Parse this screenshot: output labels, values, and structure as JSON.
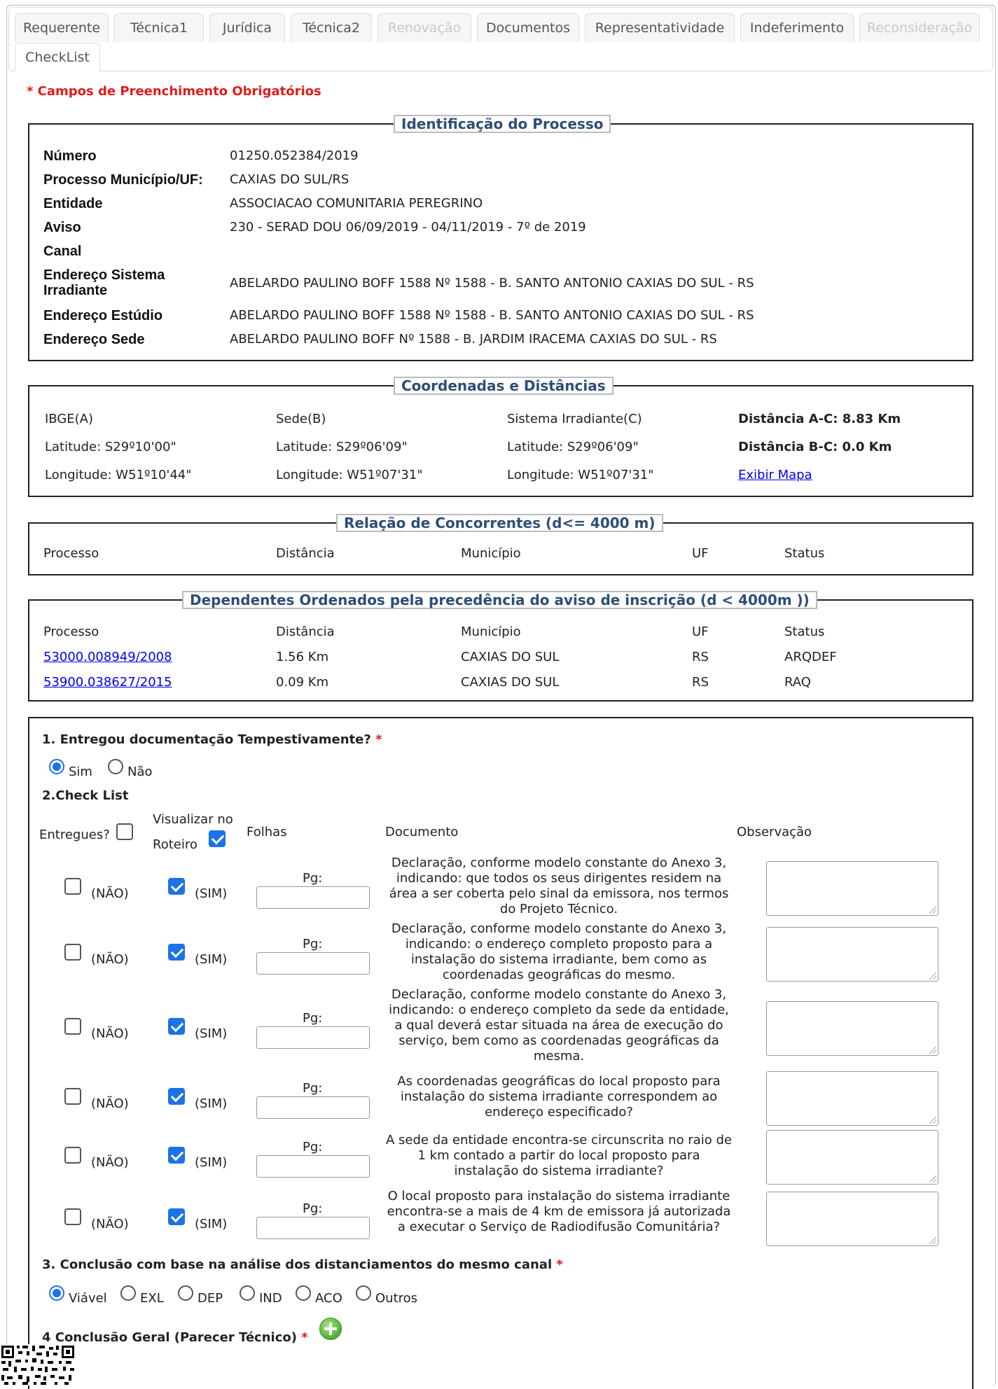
{
  "tabs": [
    {
      "label": "Requerente",
      "state": "normal"
    },
    {
      "label": "Técnica1",
      "state": "normal"
    },
    {
      "label": "Jurídica",
      "state": "normal"
    },
    {
      "label": "Técnica2",
      "state": "normal"
    },
    {
      "label": "Renovação",
      "state": "disabled"
    },
    {
      "label": "Documentos",
      "state": "normal"
    },
    {
      "label": "Representatividade",
      "state": "normal"
    },
    {
      "label": "Indeferimento",
      "state": "normal"
    },
    {
      "label": "Reconsideração",
      "state": "disabled"
    },
    {
      "label": "CheckList",
      "state": "active"
    }
  ],
  "required_note": "* Campos de Preenchimento Obrigatórios",
  "identificacao": {
    "legend": "Identificação do Processo",
    "rows": [
      {
        "label": "Número",
        "value": "01250.052384/2019"
      },
      {
        "label": "Processo Município/UF:",
        "value": "CAXIAS DO SUL/RS"
      },
      {
        "label": "Entidade",
        "value": "ASSOCIACAO COMUNITARIA PEREGRINO"
      },
      {
        "label": "Aviso",
        "value": "230 - SERAD DOU 06/09/2019 - 04/11/2019 - 7º de 2019"
      },
      {
        "label": "Canal",
        "value": ""
      },
      {
        "label": "Endereço Sistema Irradiante",
        "value": "ABELARDO PAULINO BOFF 1588 Nº 1588 - B. SANTO ANTONIO CAXIAS DO SUL - RS"
      },
      {
        "label": "Endereço Estúdio",
        "value": "ABELARDO PAULINO BOFF 1588 Nº 1588 - B. SANTO ANTONIO CAXIAS DO SUL - RS"
      },
      {
        "label": "Endereço Sede",
        "value": "ABELARDO PAULINO BOFF Nº 1588 - B. JARDIM IRACEMA CAXIAS DO SUL - RS"
      }
    ]
  },
  "coordenadas": {
    "legend": "Coordenadas e Distâncias",
    "ibge": {
      "title": "IBGE(A)",
      "lat": "Latitude: S29º10'00\"",
      "lon": "Longitude: W51º10'44\""
    },
    "sede": {
      "title": "Sede(B)",
      "lat": "Latitude: S29º06'09\"",
      "lon": "Longitude: W51º07'31\""
    },
    "sistema": {
      "title": "Sistema Irradiante(C)",
      "lat": "Latitude: S29º06'09\"",
      "lon": "Longitude: W51º07'31\""
    },
    "dist_ac": "Distância A-C: 8.83 Km",
    "dist_bc": "Distância B-C: 0.0 Km",
    "map_link": "Exibir Mapa"
  },
  "concorrentes": {
    "legend": "Relação de Concorrentes (d<= 4000 m)",
    "headers": [
      "Processo",
      "Distância",
      "Município",
      "UF",
      "Status"
    ]
  },
  "dependentes": {
    "legend": "Dependentes Ordenados pela precedência do aviso de inscrição (d < 4000m ))",
    "headers": [
      "Processo",
      "Distância",
      "Município",
      "UF",
      "Status"
    ],
    "rows": [
      {
        "processo": "53000.008949/2008",
        "distancia": "1.56 Km",
        "municipio": "CAXIAS DO SUL",
        "uf": "RS",
        "status": "ARQDEF"
      },
      {
        "processo": "53900.038627/2015",
        "distancia": "0.09 Km",
        "municipio": "CAXIAS DO SUL",
        "uf": "RS",
        "status": "RAQ"
      }
    ]
  },
  "q1": {
    "title": "1. Entregou documentação Tempestivamente?",
    "star": "*",
    "options": [
      "Sim",
      "Não"
    ],
    "selected": "Sim"
  },
  "q2": {
    "title": "2.Check List",
    "head_entregues": "Entregues?",
    "head_visualizar_1": "Visualizar no",
    "head_visualizar_2": "Roteiro",
    "head_folhas": "Folhas",
    "head_documento": "Documento",
    "head_observacao": "Observação",
    "nao_label": "(NÃO)",
    "sim_label": "(SIM)",
    "pg_label": "Pg:",
    "items": [
      {
        "doc": "Declaração, conforme modelo constante do Anexo 3, indicando: que todos os seus dirigentes residem na área a ser coberta pelo sinal da emissora, nos termos do Projeto Técnico."
      },
      {
        "doc": "Declaração, conforme modelo constante do Anexo 3, indicando: o endereço completo proposto para a instalação do sistema irradiante, bem como as coordenadas geográficas do mesmo."
      },
      {
        "doc": "Declaração, conforme modelo constante do Anexo 3, indicando: o endereço completo da sede da entidade, a qual deverá estar situada na área de execução do serviço, bem como as coordenadas geográficas da mesma."
      },
      {
        "doc": "As coordenadas geográficas do local proposto para instalação do sistema irradiante correspondem ao endereço especificado?"
      },
      {
        "doc": "A sede da entidade encontra-se circunscrita no raio de 1 km contado a partir do local proposto para instalação do sistema irradiante?"
      },
      {
        "doc": "O local proposto para instalação do sistema irradiante encontra-se a mais de 4 km de emissora já autorizada a executar o Serviço de Radiodifusão Comunitária?"
      }
    ]
  },
  "q3": {
    "title": "3. Conclusão com base na análise dos distanciamentos do mesmo canal",
    "star": "*",
    "options": [
      "Viável",
      "EXL",
      "DEP",
      "IND",
      "ACO",
      "Outros"
    ],
    "selected": "Viável"
  },
  "q4": {
    "title": "4 Conclusão Geral (Parecer Técnico)",
    "star": "*"
  },
  "colors": {
    "accent": "#1a73e8",
    "legend": "#2d4e77",
    "required": "#e21b1b"
  }
}
